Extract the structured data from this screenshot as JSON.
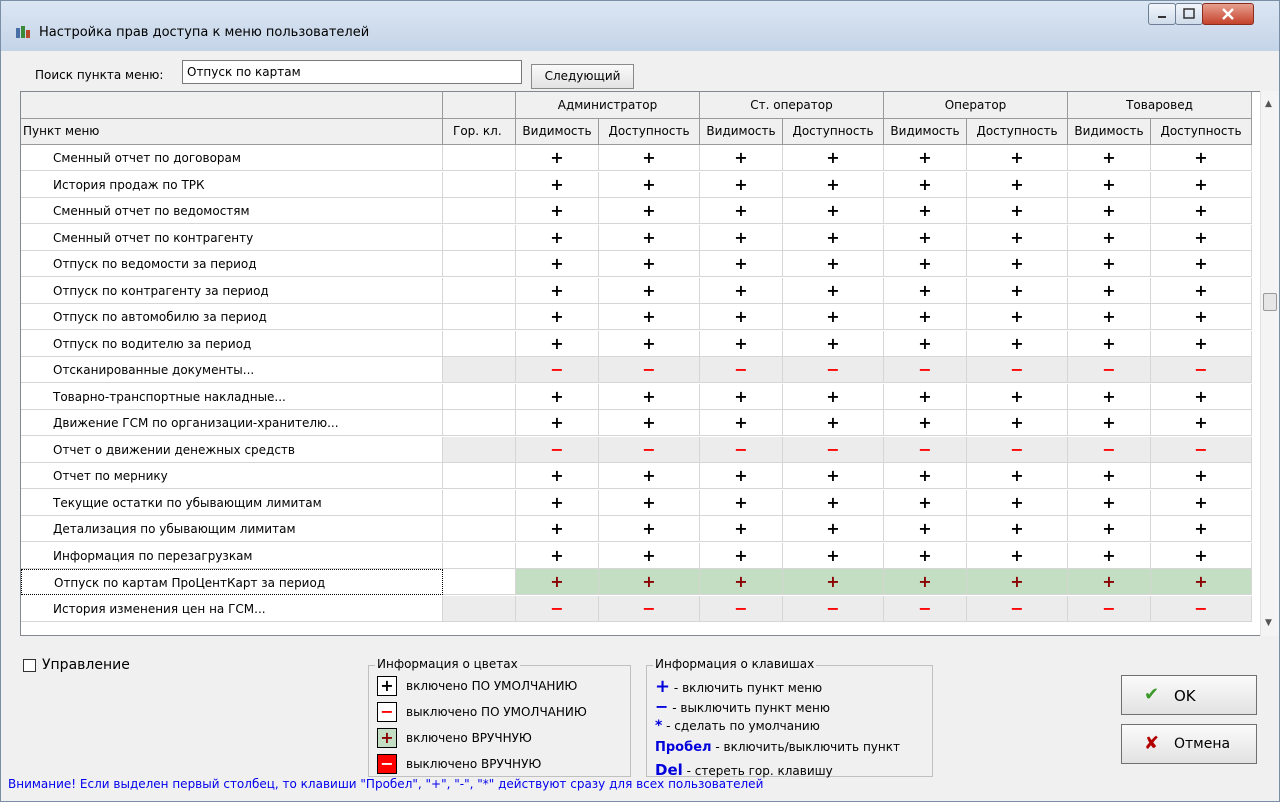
{
  "window": {
    "title": "Настройка прав доступа к меню пользователей"
  },
  "search": {
    "label": "Поиск пункта меню:",
    "value": "Отпуск по картам",
    "next_label": "Следующий"
  },
  "table": {
    "col_item": "Пункт меню",
    "col_hotkey": "Гор. кл.",
    "roles": [
      "Администратор",
      "Ст. оператор",
      "Оператор",
      "Товаровед"
    ],
    "sub_visibility": "Видимость",
    "sub_access": "Доступность",
    "rows": [
      {
        "name": "Сменный отчет по договорам",
        "state": "+"
      },
      {
        "name": "История продаж по ТРК",
        "state": "+"
      },
      {
        "name": "Сменный отчет по ведомостям",
        "state": "+"
      },
      {
        "name": "Сменный отчет по контрагенту",
        "state": "+"
      },
      {
        "name": "Отпуск по ведомости за период",
        "state": "+"
      },
      {
        "name": "Отпуск по контрагенту за период",
        "state": "+"
      },
      {
        "name": "Отпуск по автомобилю за период",
        "state": "+"
      },
      {
        "name": "Отпуск по водителю за период",
        "state": "+"
      },
      {
        "name": "Отсканированные документы...",
        "state": "-"
      },
      {
        "name": "Товарно-транспортные накладные...",
        "state": "+"
      },
      {
        "name": "Движение ГСМ по организации-хранителю...",
        "state": "+"
      },
      {
        "name": "Отчет о движении денежных средств",
        "state": "-"
      },
      {
        "name": "Отчет по мернику",
        "state": "+"
      },
      {
        "name": "Текущие остатки по убывающим лимитам",
        "state": "+"
      },
      {
        "name": "Детализация по убывающим лимитам",
        "state": "+"
      },
      {
        "name": "Информация по перезагрузкам",
        "state": "+"
      },
      {
        "name": "Отпуск по картам ПроЦентКарт за период",
        "state": "+",
        "selected": true
      },
      {
        "name": "История изменения цен на ГСМ...",
        "state": "-"
      }
    ]
  },
  "manage": {
    "label": "Управление"
  },
  "colors_info": {
    "title": "Информация о цветах",
    "items": [
      {
        "symbol": "+",
        "text": "включено ПО УМОЛЧАНИЮ"
      },
      {
        "symbol": "−",
        "text": "выключено ПО УМОЛЧАНИЮ"
      },
      {
        "symbol": "+",
        "text": "включено ВРУЧНУЮ"
      },
      {
        "symbol": "−",
        "text": "выключено ВРУЧНУЮ"
      }
    ]
  },
  "keys_info": {
    "title": "Информация о клавишах",
    "items": [
      {
        "key": "+",
        "text": "- включить пункт меню"
      },
      {
        "key": "−",
        "text": "- выключить пункт меню"
      },
      {
        "key": "*",
        "text": "- сделать по умолчанию"
      },
      {
        "key": "Пробел",
        "text": "- включить/выключить пункт"
      },
      {
        "key": "Del",
        "text": "- стереть гор. клавишу"
      }
    ]
  },
  "buttons": {
    "ok": "OK",
    "cancel": "Отмена"
  },
  "warning": "Внимание! Если выделен первый столбец, то клавиши \"Пробел\", \"+\", \"-\", \"*\" действуют сразу для всех пользователей",
  "colors": {
    "selected_row": "#c3dec3",
    "minus": "#ff0000",
    "info_text": "#0000ee"
  }
}
